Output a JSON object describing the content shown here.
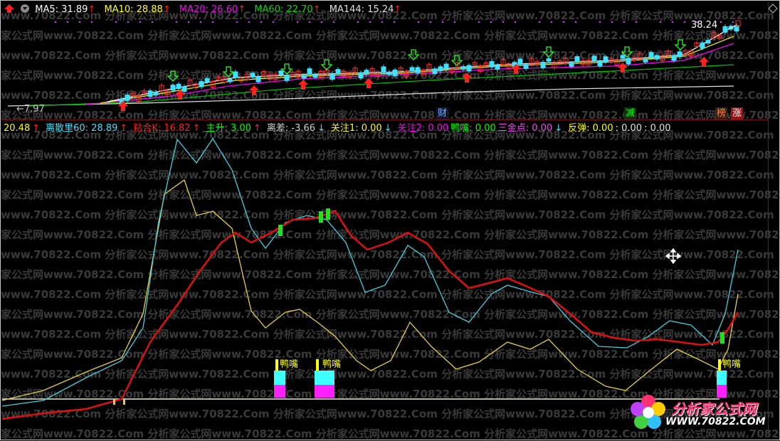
{
  "main_chart": {
    "ma5": {
      "label": "MA5: 31.89",
      "color": "#ffffff"
    },
    "ma10": {
      "label": "MA10: 28.88",
      "color": "#ffff00"
    },
    "ma20": {
      "label": "MA20: 26.60",
      "color": "#ff00ff"
    },
    "ma60": {
      "label": "MA60: 22.70",
      "color": "#00e000"
    },
    "ma144": {
      "label": "MA144: 15.24",
      "color": "#e0e0e0"
    },
    "high_label": "38.24",
    "low_label": "←7.97",
    "event_tags": [
      {
        "text": "财",
        "color": "#7fa8ff"
      },
      {
        "text": "减",
        "color": "#00ff00"
      },
      {
        "text": "榜",
        "color": "#ff8040"
      },
      {
        "text": "涨",
        "color": "#ffffff"
      }
    ]
  },
  "indicator": {
    "items": [
      {
        "label": "20.48",
        "color": "#ffff00"
      },
      {
        "label": "↑",
        "color": "#ff2020"
      },
      {
        "label": "离散里60: 28.89",
        "color": "#40e0ff"
      },
      {
        "label": "↑",
        "color": "#ff2020"
      },
      {
        "label": "粘合K: 16.82",
        "color": "#ff2020"
      },
      {
        "label": "↑",
        "color": "#ff2020"
      },
      {
        "label": "主升: 3.00",
        "color": "#00ff00"
      },
      {
        "label": "↑",
        "color": "#ff2020"
      },
      {
        "label": "离差: -3.66",
        "color": "#d0d0d0"
      },
      {
        "label": "↓",
        "color": "#40e0ff"
      },
      {
        "label": "关注1: 0.00",
        "color": "#ffff00"
      },
      {
        "label": "↓",
        "color": "#40e0ff"
      },
      {
        "label": "关注2: 0.00",
        "color": "#ff00ff"
      },
      {
        "label": "鸭嘴: 0.00",
        "color": "#00ff00"
      },
      {
        "label": "三金点: 0.00",
        "color": "#ff40ff"
      },
      {
        "label": "↓",
        "color": "#40e0ff"
      },
      {
        "label": "反弹: 0.00",
        "color": "#ffff00"
      },
      {
        "label": ": 0.00",
        "color": "#e0e0e0"
      },
      {
        "label": ": 0.00",
        "color": "#e0e0e0"
      }
    ],
    "duckbill_label": "鸭嘴"
  },
  "watermark": {
    "text": "分析家公式网www.70822.Com"
  },
  "logo": {
    "name": "分析家公式网",
    "url": "WWW.70822.COM"
  },
  "colors": {
    "cyan_line": "#40d0e0",
    "yellow_line": "#e8d040",
    "red_line": "#e01010",
    "up_arrow": "#ff2020",
    "down_arrow": "#20ff20"
  }
}
